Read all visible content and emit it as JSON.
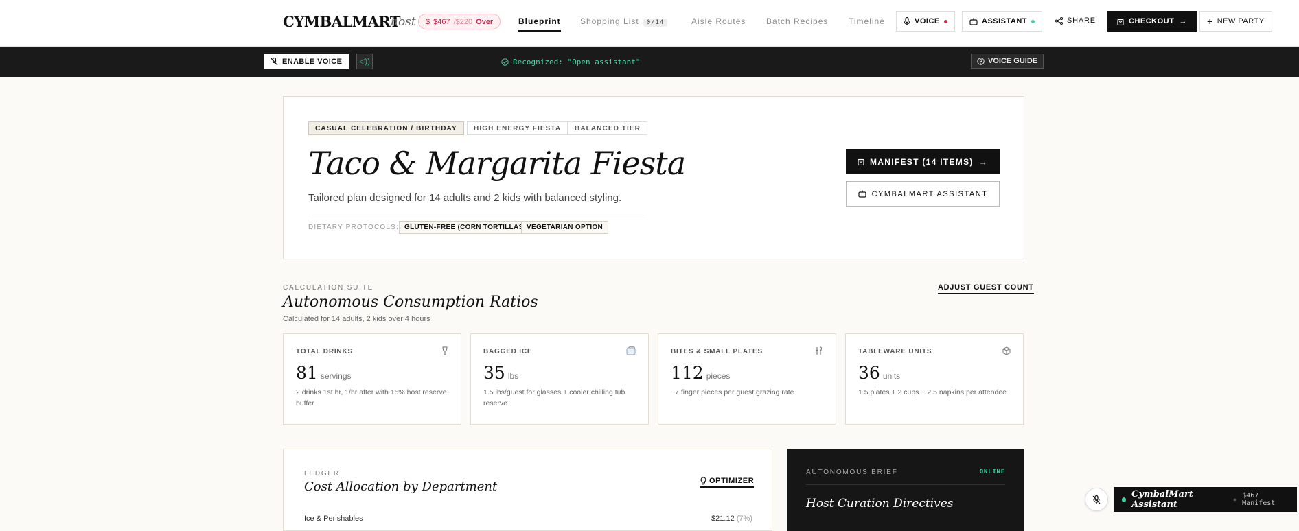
{
  "nav": {
    "brand": "CYMBALMART",
    "brand_sub": "host",
    "budget": {
      "spent": "$467",
      "limit": "/$220",
      "status": "Over",
      "symbol": "$"
    },
    "tabs": [
      {
        "label": "Blueprint"
      },
      {
        "label": "Shopping List",
        "badge": "0/14"
      },
      {
        "label": "Aisle Routes"
      },
      {
        "label": "Batch Recipes"
      },
      {
        "label": "Timeline"
      }
    ],
    "voice_label": "VOICE",
    "assistant_label": "ASSISTANT",
    "share_label": "SHARE",
    "checkout_label": "CHECKOUT",
    "new_party_label": "NEW PARTY"
  },
  "voicebar": {
    "enable_label": "ENABLE VOICE",
    "recognized": "Recognized: \"Open assistant\"",
    "guide_label": "VOICE GUIDE"
  },
  "hero": {
    "tags": [
      "CASUAL CELEBRATION / BIRTHDAY",
      "HIGH ENERGY FIESTA",
      "BALANCED TIER"
    ],
    "title": "Taco & Margarita Fiesta",
    "subtitle": "Tailored plan designed for 14 adults and 2 kids with balanced styling.",
    "diet_label": "DIETARY PROTOCOLS:",
    "diets": [
      "GLUTEN-FREE (CORN TORTILLAS)",
      "VEGETARIAN OPTION"
    ],
    "manifest_label": "MANIFEST (14 ITEMS)",
    "assistant_label": "CYMBALMART ASSISTANT"
  },
  "calc": {
    "eyebrow": "CALCULATION SUITE",
    "title": "Autonomous Consumption Ratios",
    "subtitle": "Calculated for 14 adults, 2 kids over 4 hours",
    "adjust_label": "ADJUST GUEST COUNT",
    "cards": [
      {
        "label": "TOTAL DRINKS",
        "icon": "wine-glass-icon",
        "value": "81",
        "unit": "servings",
        "desc": "2 drinks 1st hr, 1/hr after with 15% host reserve buffer"
      },
      {
        "label": "BAGGED ICE",
        "icon": "ice-cube-icon",
        "value": "35",
        "unit": "lbs",
        "desc": "1.5 lbs/guest for glasses + cooler chilling tub reserve"
      },
      {
        "label": "BITES & SMALL PLATES",
        "icon": "utensils-icon",
        "value": "112",
        "unit": "pieces",
        "desc": "~7 finger pieces per guest grazing rate"
      },
      {
        "label": "TABLEWARE UNITS",
        "icon": "box-icon",
        "value": "36",
        "unit": "units",
        "desc": "1.5 plates + 2 cups + 2.5 napkins per attendee"
      }
    ]
  },
  "ledger": {
    "eyebrow": "LEDGER",
    "title": "Cost Allocation by Department",
    "optimizer_label": "OPTIMIZER",
    "first_row": {
      "label": "Ice & Perishables",
      "amount": "$21.12",
      "pct": "(7%)"
    }
  },
  "brief": {
    "eyebrow": "AUTONOMOUS BRIEF",
    "status": "ONLINE",
    "title": "Host Curation Directives"
  },
  "floating": {
    "name": "CymbalMart Assistant",
    "manifest": "$467 Manifest"
  },
  "colors": {
    "accent_green": "#3fd29c",
    "alert_red": "#e0264c",
    "ink": "#111111"
  }
}
